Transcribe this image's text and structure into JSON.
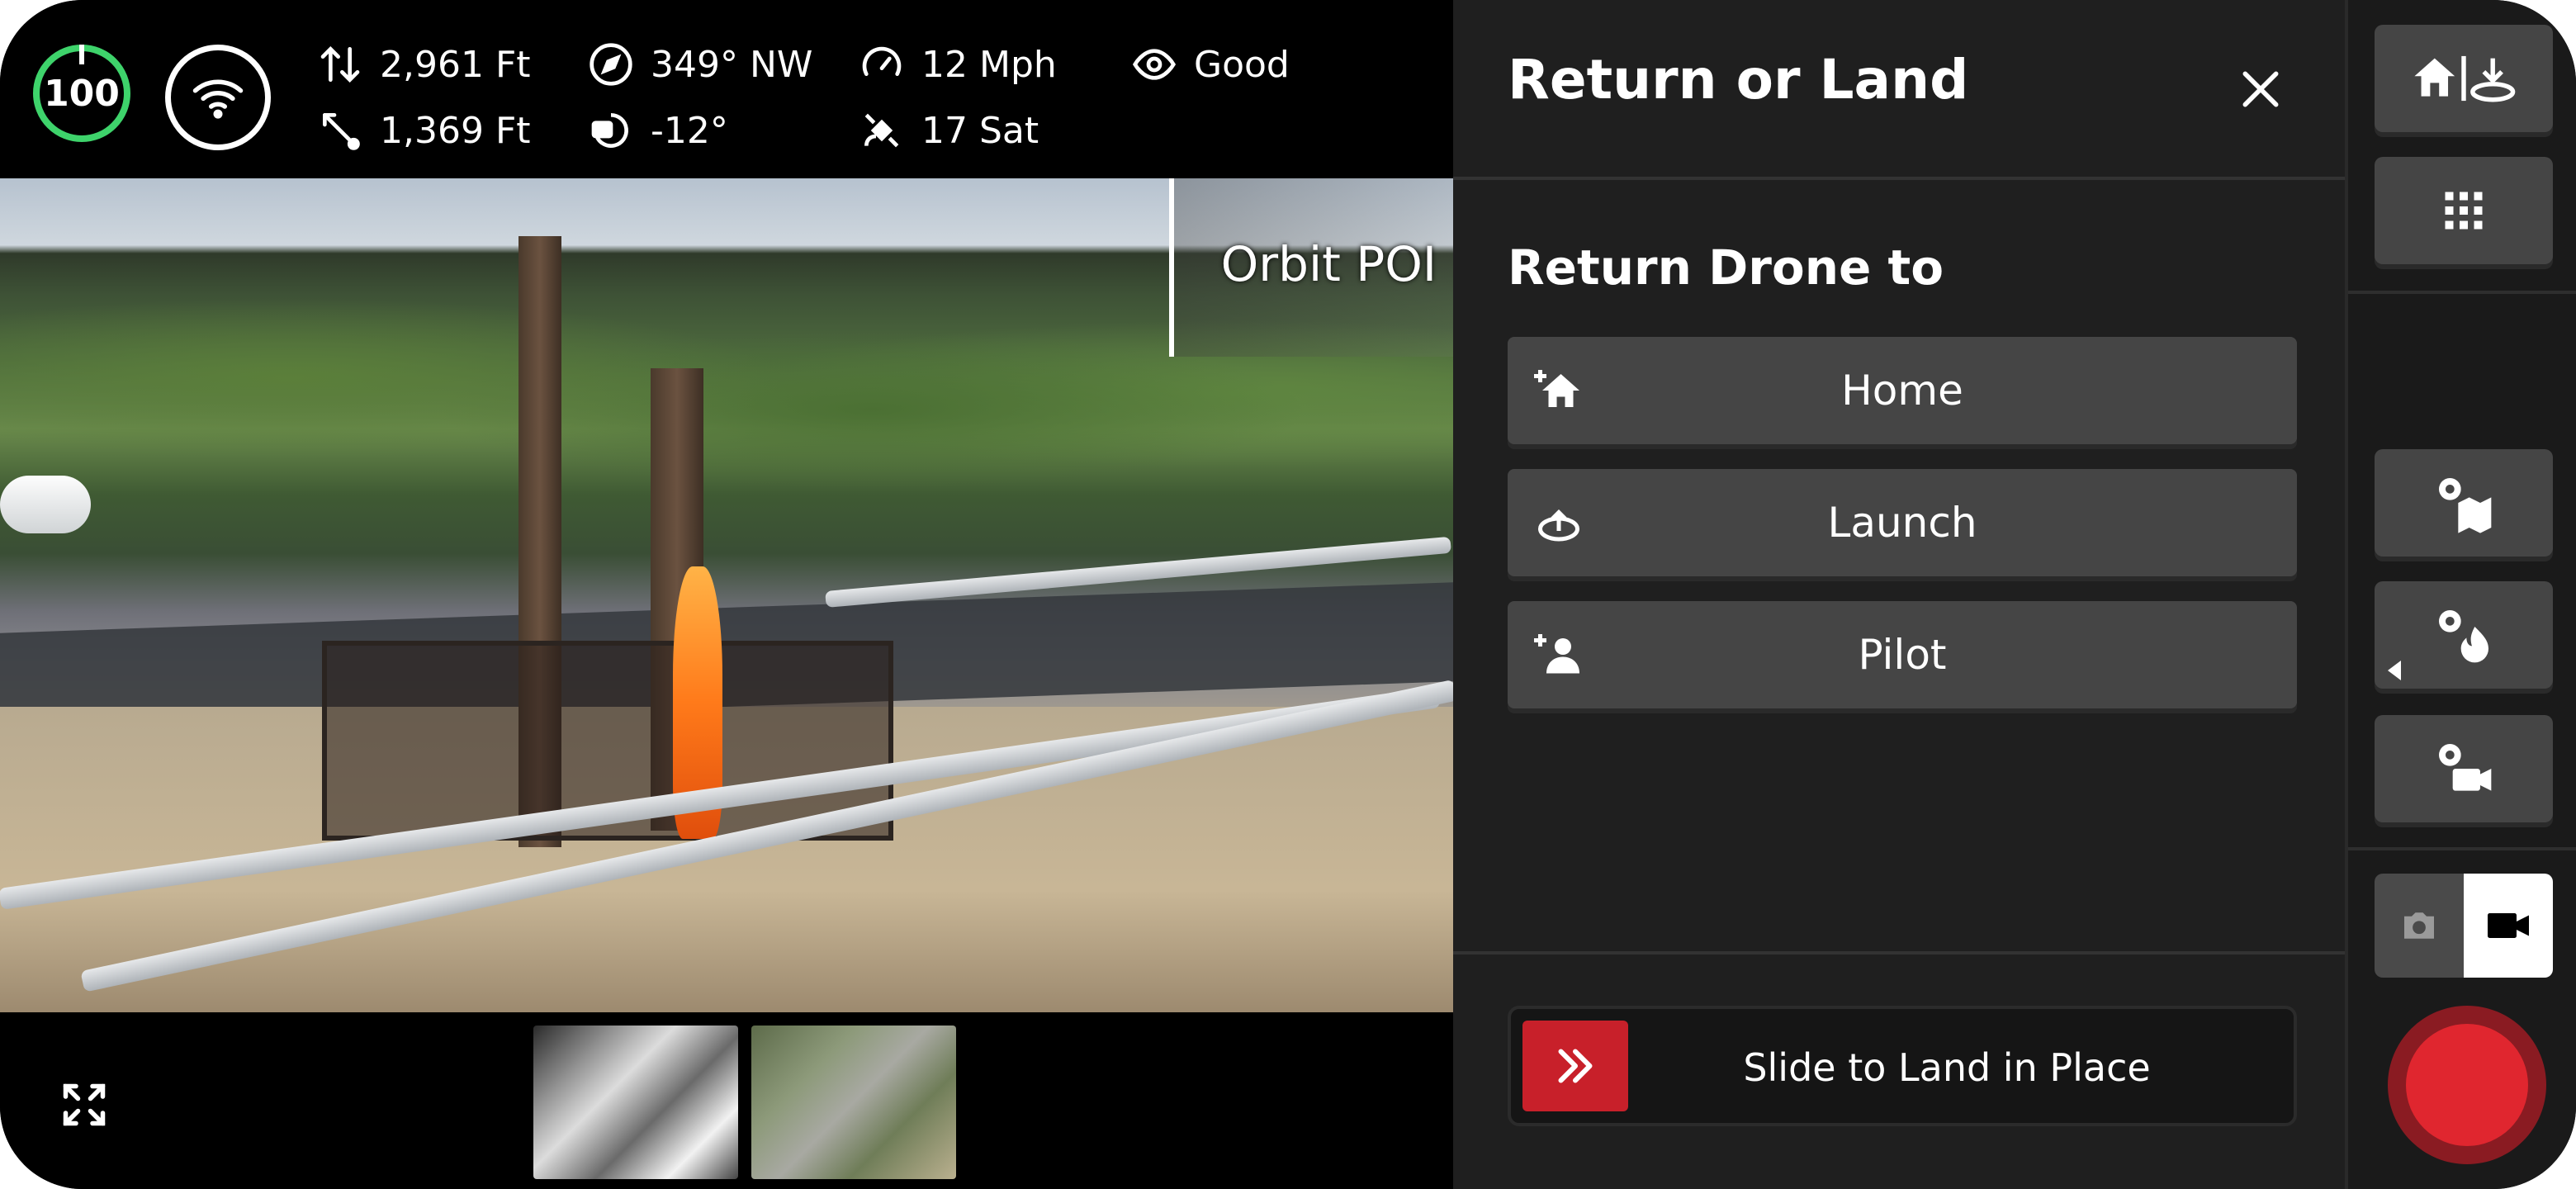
{
  "telemetry": {
    "battery": "100",
    "altitude": "2,961 Ft",
    "distance": "1,369 Ft",
    "heading": "349° NW",
    "gimbal_pitch": "-12°",
    "speed": "12 Mph",
    "satellites": "17 Sat",
    "visibility": "Good"
  },
  "video": {
    "overlay_label": "Orbit POI"
  },
  "panel": {
    "title": "Return or Land",
    "section_title": "Return Drone to",
    "options": [
      {
        "label": "Home"
      },
      {
        "label": "Launch"
      },
      {
        "label": "Pilot"
      }
    ],
    "slider_label": "Slide to Land in Place"
  },
  "colors": {
    "battery_ring": "#3ed36b",
    "accent_red": "#c8202a",
    "record": "#e0262f"
  },
  "icons": [
    "wifi-icon",
    "altitude-icon",
    "distance-icon",
    "compass-icon",
    "gimbal-icon",
    "speedometer-icon",
    "satellite-icon",
    "eye-icon",
    "close-icon",
    "home-plus-icon",
    "launch-icon",
    "pilot-icon",
    "chevrons-right-icon",
    "home-land-icon",
    "grid-icon",
    "map-settings-icon",
    "fire-settings-icon",
    "camera-settings-icon",
    "photo-camera-icon",
    "video-camera-icon",
    "fullscreen-icon"
  ]
}
